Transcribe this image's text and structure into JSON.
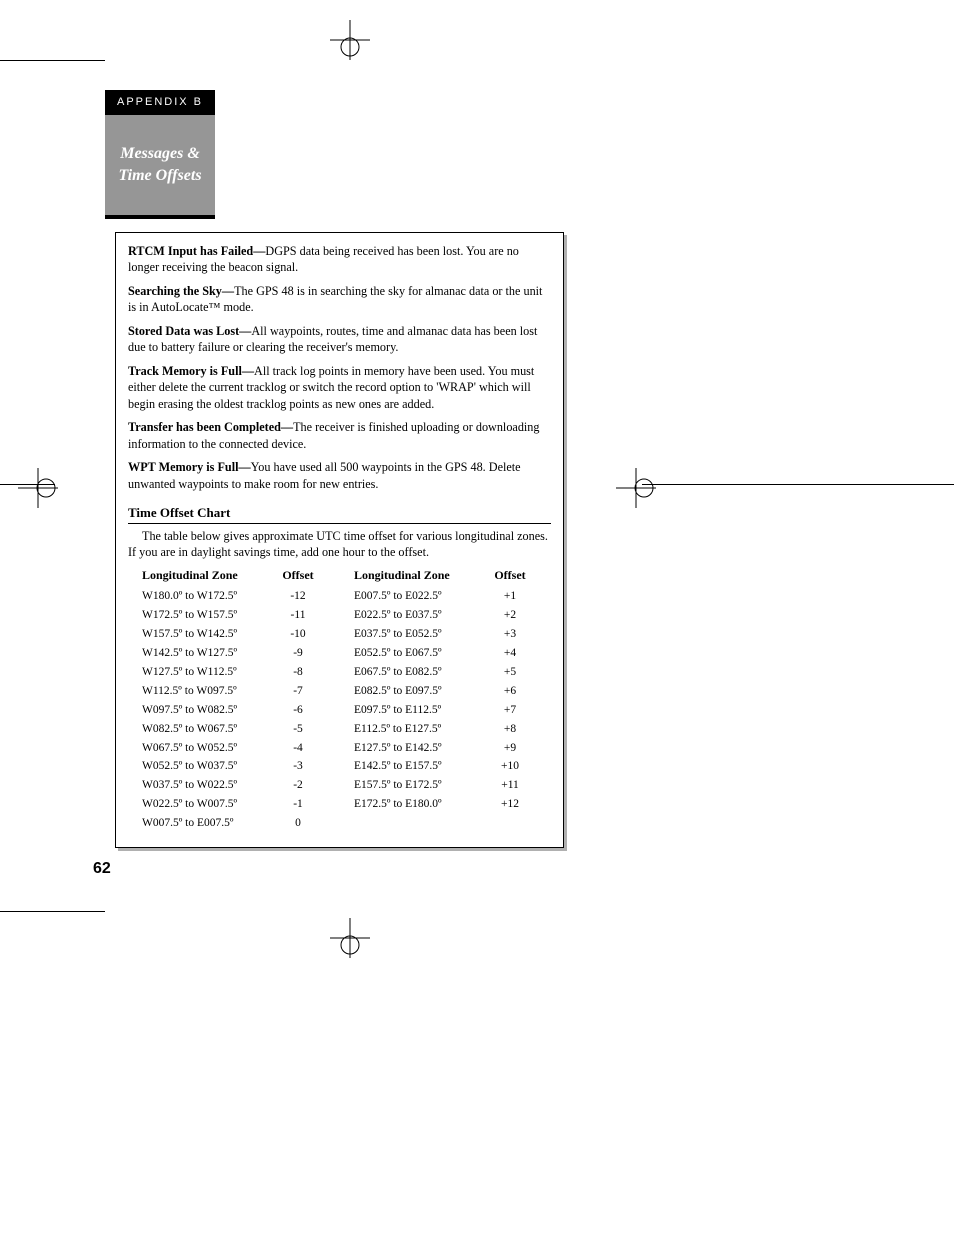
{
  "appendix_label": "APPENDIX B",
  "sidebar_title_line1": "Messages &",
  "sidebar_title_line2": "Time Offsets",
  "messages": [
    {
      "head": "RTCM Input has Failed—",
      "body": "DGPS data being received has been lost. You are no longer receiving the beacon signal."
    },
    {
      "head": "Searching the Sky—",
      "body": "The GPS 48 is in searching the sky for almanac data or the unit is in AutoLocate™ mode."
    },
    {
      "head": "Stored Data was Lost—",
      "body": "All waypoints, routes, time and almanac data has been lost due to battery failure or clearing the receiver's memory."
    },
    {
      "head": "Track Memory is Full—",
      "body": "All track log points in memory have been used. You must either delete the current tracklog or switch the record option to 'WRAP' which will begin erasing the oldest tracklog points as new ones are added."
    },
    {
      "head": "Transfer has been Completed—",
      "body": "The receiver is finished uploading or downloading information to the connected device."
    },
    {
      "head": "WPT Memory is Full—",
      "body": "You have used all 500 waypoints in the GPS 48. Delete unwanted waypoints to make room for new entries."
    }
  ],
  "chart_heading": "Time Offset Chart",
  "chart_intro": "The table below gives approximate UTC time offset for various longitudinal zones. If you are in daylight savings time, add one hour to the offset.",
  "col_zone": "Longitudinal Zone",
  "col_offset": "Offset",
  "left_rows": [
    {
      "zone": "W180.0º to W172.5º",
      "offset": "-12"
    },
    {
      "zone": "W172.5º to W157.5º",
      "offset": "-11"
    },
    {
      "zone": "W157.5º to W142.5º",
      "offset": "-10"
    },
    {
      "zone": "W142.5º to W127.5º",
      "offset": "-9"
    },
    {
      "zone": "W127.5º to W112.5º",
      "offset": "-8"
    },
    {
      "zone": "W112.5º to W097.5º",
      "offset": "-7"
    },
    {
      "zone": "W097.5º to W082.5º",
      "offset": "-6"
    },
    {
      "zone": "W082.5º to W067.5º",
      "offset": "-5"
    },
    {
      "zone": "W067.5º to W052.5º",
      "offset": "-4"
    },
    {
      "zone": "W052.5º to W037.5º",
      "offset": "-3"
    },
    {
      "zone": "W037.5º to W022.5º",
      "offset": "-2"
    },
    {
      "zone": "W022.5º to W007.5º",
      "offset": "-1"
    },
    {
      "zone": "W007.5º to E007.5º",
      "offset": "0"
    }
  ],
  "right_rows": [
    {
      "zone": "E007.5º to E022.5º",
      "offset": "+1"
    },
    {
      "zone": "E022.5º to E037.5º",
      "offset": "+2"
    },
    {
      "zone": "E037.5º to E052.5º",
      "offset": "+3"
    },
    {
      "zone": "E052.5º to E067.5º",
      "offset": "+4"
    },
    {
      "zone": "E067.5º to E082.5º",
      "offset": "+5"
    },
    {
      "zone": "E082.5º to E097.5º",
      "offset": "+6"
    },
    {
      "zone": "E097.5º to E112.5º",
      "offset": "+7"
    },
    {
      "zone": "E112.5º to E127.5º",
      "offset": "+8"
    },
    {
      "zone": "E127.5º to E142.5º",
      "offset": "+9"
    },
    {
      "zone": "E142.5º to E157.5º",
      "offset": "+10"
    },
    {
      "zone": "E157.5º to E172.5º",
      "offset": "+11"
    },
    {
      "zone": "E172.5º to E180.0º",
      "offset": "+12"
    }
  ],
  "page_number": "62",
  "chart_data": {
    "type": "table",
    "title": "Time Offset Chart",
    "columns": [
      "Longitudinal Zone",
      "Offset"
    ],
    "rows": [
      [
        "W180.0º to W172.5º",
        -12
      ],
      [
        "W172.5º to W157.5º",
        -11
      ],
      [
        "W157.5º to W142.5º",
        -10
      ],
      [
        "W142.5º to W127.5º",
        -9
      ],
      [
        "W127.5º to W112.5º",
        -8
      ],
      [
        "W112.5º to W097.5º",
        -7
      ],
      [
        "W097.5º to W082.5º",
        -6
      ],
      [
        "W082.5º to W067.5º",
        -5
      ],
      [
        "W067.5º to W052.5º",
        -4
      ],
      [
        "W052.5º to W037.5º",
        -3
      ],
      [
        "W037.5º to W022.5º",
        -2
      ],
      [
        "W022.5º to W007.5º",
        -1
      ],
      [
        "W007.5º to E007.5º",
        0
      ],
      [
        "E007.5º to E022.5º",
        1
      ],
      [
        "E022.5º to E037.5º",
        2
      ],
      [
        "E037.5º to E052.5º",
        3
      ],
      [
        "E052.5º to E067.5º",
        4
      ],
      [
        "E067.5º to E082.5º",
        5
      ],
      [
        "E082.5º to E097.5º",
        6
      ],
      [
        "E097.5º to E112.5º",
        7
      ],
      [
        "E112.5º to E127.5º",
        8
      ],
      [
        "E127.5º to E142.5º",
        9
      ],
      [
        "E142.5º to E157.5º",
        10
      ],
      [
        "E157.5º to E172.5º",
        11
      ],
      [
        "E172.5º to E180.0º",
        12
      ]
    ]
  }
}
